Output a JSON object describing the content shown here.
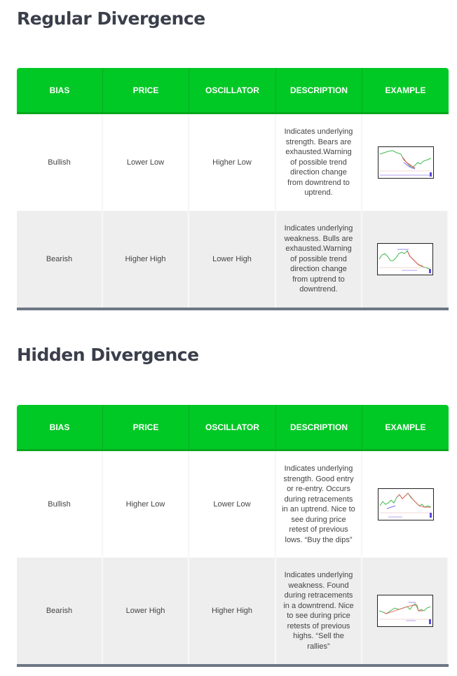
{
  "sections": [
    {
      "title": "Regular Divergence",
      "headers": [
        "BIAS",
        "PRICE",
        "OSCILLATOR",
        "DESCRIPTION",
        "EXAMPLE"
      ],
      "rows": [
        {
          "bias": "Bullish",
          "price": "Lower Low",
          "oscillator": "Higher Low",
          "description": "Indicates underlying strength. Bears are exhausted.Warning of possible trend direction change from downtrend to uptrend.",
          "example": "bullish-regular-divergence-chart-thumbnail"
        },
        {
          "bias": "Bearish",
          "price": "Higher High",
          "oscillator": "Lower High",
          "description": "Indicates underlying weakness. Bulls are exhausted.Warning of possible trend direction change from uptrend to downtrend.",
          "example": "bearish-regular-divergence-chart-thumbnail"
        }
      ]
    },
    {
      "title": "Hidden Divergence",
      "headers": [
        "BIAS",
        "PRICE",
        "OSCILLATOR",
        "DESCRIPTION",
        "EXAMPLE"
      ],
      "rows": [
        {
          "bias": "Bullish",
          "price": "Higher Low",
          "oscillator": "Lower Low",
          "description": "Indicates underlying strength. Good entry or re-entry. Occurs during retracements in an uptrend. Nice to see during price retest of previous lows. “Buy the dips”",
          "example": "bullish-hidden-divergence-chart-thumbnail"
        },
        {
          "bias": "Bearish",
          "price": "Lower High",
          "oscillator": "Higher High",
          "description": "Indicates underlying weakness. Found during retracements in a downtrend. Nice to see during price retests of previous highs. “Sell the rallies”",
          "example": "bearish-hidden-divergence-chart-thumbnail"
        }
      ]
    }
  ],
  "colors": {
    "header_green": "#00c825",
    "title_text": "#3a3f4b",
    "footer_bar": "#6d7684",
    "row_alt": "#eeeeee"
  }
}
